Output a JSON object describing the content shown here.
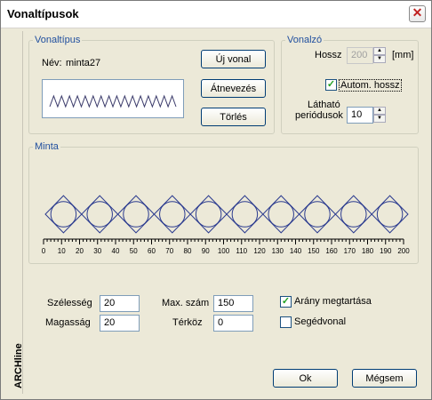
{
  "window": {
    "title": "Vonaltípusok"
  },
  "sidebar": {
    "label": "ARCHline"
  },
  "vonaltipus": {
    "legend": "Vonaltípus",
    "name_label": "Név:",
    "name_value": "minta27",
    "new_button": "Új vonal",
    "rename_button": "Átnevezés",
    "delete_button": "Törlés"
  },
  "vonalzo": {
    "legend": "Vonalzó",
    "length_label": "Hossz",
    "length_value": "200",
    "length_unit": "[mm]",
    "auto_length_label": "Autom. hossz",
    "auto_length_checked": true,
    "visible_periods_label_1": "Látható",
    "visible_periods_label_2": "periódusok",
    "visible_periods_value": "10"
  },
  "minta": {
    "legend": "Minta",
    "ruler_ticks": [
      "0",
      "10",
      "20",
      "30",
      "40",
      "50",
      "60",
      "70",
      "80",
      "90",
      "100",
      "110",
      "120",
      "130",
      "140",
      "150",
      "160",
      "170",
      "180",
      "190",
      "200"
    ]
  },
  "params": {
    "width_label": "Szélesség",
    "width_value": "20",
    "height_label": "Magasság",
    "height_value": "20",
    "max_label": "Max. szám",
    "max_value": "150",
    "gap_label": "Térköz",
    "gap_value": "0",
    "keep_ratio_label": "Arány megtartása",
    "keep_ratio_checked": true,
    "helper_line_label": "Segédvonal",
    "helper_line_checked": false
  },
  "footer": {
    "ok": "Ok",
    "cancel": "Mégsem"
  },
  "colors": {
    "legend": "#1f4e9e",
    "pattern": "#2b3b8f",
    "face": "#ece9d8"
  }
}
